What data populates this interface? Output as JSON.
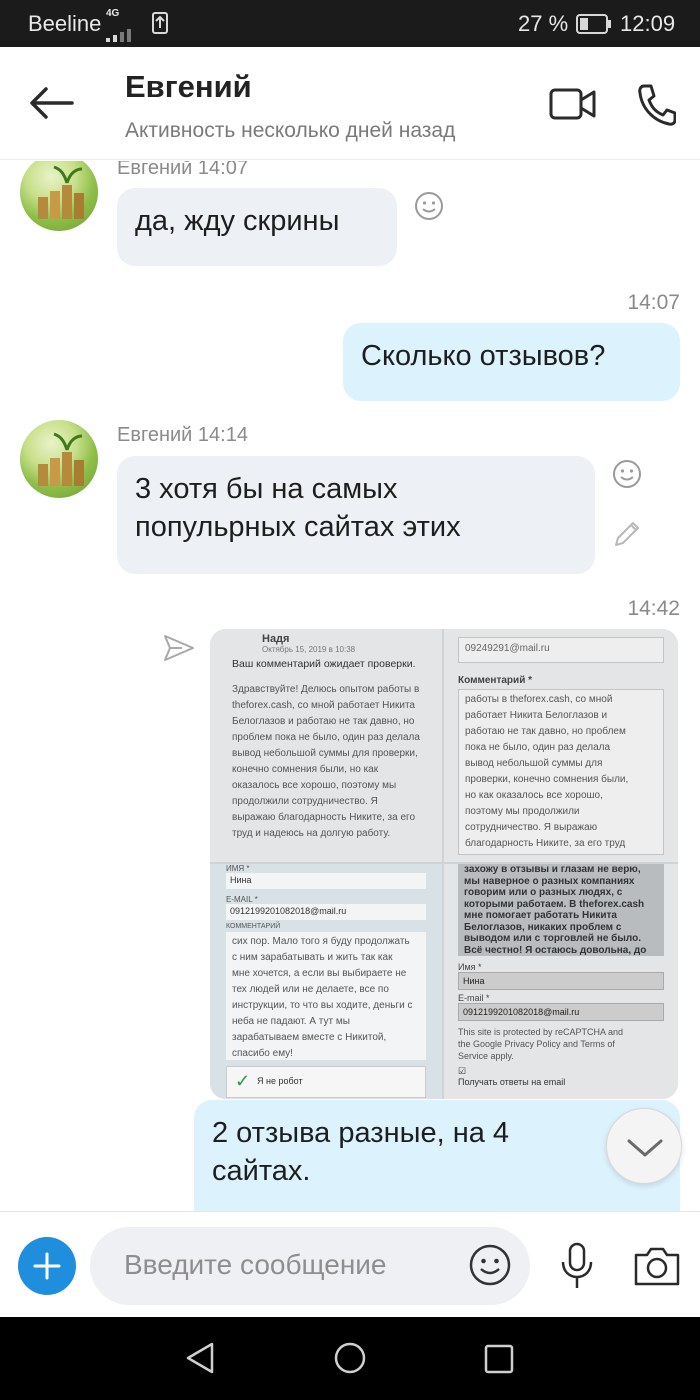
{
  "status_bar": {
    "carrier": "Beeline",
    "network": "4G",
    "battery_percent": "27 %",
    "time": "12:09"
  },
  "header": {
    "contact_name": "Евгений",
    "activity": "Активность несколько дней назад"
  },
  "messages": [
    {
      "sender_line": "Евгений 14:07",
      "text": "да, жду скрины"
    },
    {
      "time": "14:07",
      "text": "Сколько отзывов?"
    },
    {
      "sender_line": "Евгений 14:14",
      "lines": [
        "3 хотя бы на самых",
        "попульрных сайтах этих"
      ]
    },
    {
      "time": "14:42",
      "lines": [
        "2 отзыва разные, на 4",
        "сайтах."
      ]
    }
  ],
  "collage": {
    "tile1": {
      "name": "Надя",
      "date": "Октябрь 15, 2019 в 10:38",
      "notice": "Ваш комментарий ожидает проверки.",
      "lines": [
        "Здравствуйте! Делюсь опытом работы в",
        "theforex.cash, со мной работает Никита",
        "Белоглазов и работаю не так давно, но",
        "проблем пока не было, один раз делала",
        "вывод небольшой суммы для проверки,",
        "конечно сомнения были, но как",
        "оказалось все хорошо, поэтому мы",
        "продолжили сотрудничество. Я",
        "выражаю благодарность Никите, за его",
        "труд и надеюсь на долгую работу."
      ]
    },
    "tile2": {
      "email": "09249291@mail.ru",
      "comment_label": "Комментарий *",
      "lines": [
        "работы в theforex.cash, со мной",
        "работает Никита Белоглазов и",
        "работаю не так давно, но проблем",
        "пока не было, один раз делала",
        "вывод небольшой суммы для",
        "проверки, конечно сомнения были,",
        "но как оказалось все хорошо,",
        "поэтому мы продолжили",
        "сотрудничество. Я выражаю",
        "благодарность Никите, за его труд"
      ]
    },
    "tile3": {
      "name_label": "ИМЯ *",
      "name": "Нина",
      "email_label": "E-MAIL *",
      "email": "0912199201082018@mail.ru",
      "comment_label": "КОММЕНТАРИЙ",
      "lines": [
        "сих пор. Мало того я буду продолжать",
        "с ним зарабатывать и жить так как",
        "мне хочется, а если вы выбираете не",
        "тех людей или не делаете, все по",
        "инструкции, то что вы ходите, деньги с",
        "неба не падают. А тут мы",
        "зарабатываем вместе с Никитой,",
        "спасибо ему!"
      ],
      "captcha": "Я не робот"
    },
    "tile4": {
      "lines": [
        "захожу в отзывы и глазам не верю,",
        "мы наверное о разных компаниях",
        "говорим или о разных людях, с",
        "которыми работаем. В theforex.cash",
        "мне помогает работать Никита",
        "Белоглазов, никаких проблем с",
        "выводом или с торговлей не было.",
        "Всё честно! Я остаюсь довольна, до"
      ],
      "name_label": "Имя *",
      "name": "Нина",
      "email_label": "E-mail *",
      "email": "0912199201082018@mail.ru",
      "recaptcha_lines": [
        "This site is protected by reCAPTCHA and",
        "the Google Privacy Policy and Terms of",
        "Service apply."
      ],
      "notify": "Получать ответы на email"
    }
  },
  "composer": {
    "placeholder": "Введите сообщение"
  },
  "colors": {
    "accent": "#1f8fdd",
    "incoming_bubble": "#edf0f4",
    "outgoing_bubble": "#dcf2fd"
  }
}
